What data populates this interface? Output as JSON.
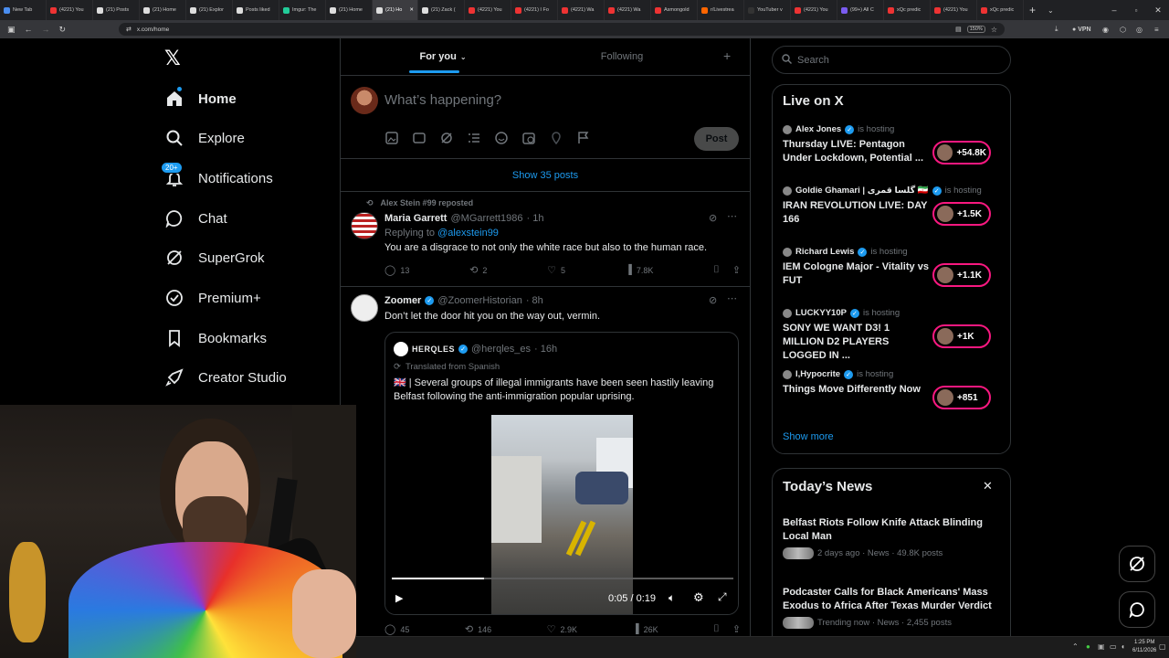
{
  "browser": {
    "tabs": [
      {
        "label": "New Tab",
        "color": "#4a8ef0"
      },
      {
        "label": "(4221) You",
        "color": "#e33"
      },
      {
        "label": "(21) Posts",
        "color": "#ddd"
      },
      {
        "label": "(21) Home",
        "color": "#ddd"
      },
      {
        "label": "(21) Explor",
        "color": "#ddd"
      },
      {
        "label": "Posts liked",
        "color": "#ddd"
      },
      {
        "label": "Imgur: The",
        "color": "#2c9"
      },
      {
        "label": "(21) Home",
        "color": "#ddd"
      },
      {
        "label": "(21) Ho",
        "color": "#ddd",
        "active": true
      },
      {
        "label": "(21) Zack (",
        "color": "#ddd"
      },
      {
        "label": "(4221) You",
        "color": "#e33"
      },
      {
        "label": "(4221) I Fo",
        "color": "#e33"
      },
      {
        "label": "(4221) Wa",
        "color": "#e33"
      },
      {
        "label": "(4221) Wa",
        "color": "#e33"
      },
      {
        "label": "Asmongold",
        "color": "#e33"
      },
      {
        "label": "r/Livestrea",
        "color": "#f60"
      },
      {
        "label": "YouTuber v",
        "color": "#333"
      },
      {
        "label": "(4221) You",
        "color": "#e33"
      },
      {
        "label": "(99+) All C",
        "color": "#7a5cf0"
      },
      {
        "label": "xQc predic",
        "color": "#e33"
      },
      {
        "label": "(4221) You",
        "color": "#e33"
      },
      {
        "label": "xQc predic",
        "color": "#e33"
      }
    ],
    "url": "x.com/home",
    "zoom": "150%",
    "vpn": "VPN"
  },
  "nav": {
    "home": "Home",
    "explore": "Explore",
    "notifications": "Notifications",
    "notif_badge": "20+",
    "chat": "Chat",
    "supergrok": "SuperGrok",
    "premium": "Premium+",
    "bookmarks": "Bookmarks",
    "creator": "Creator Studio"
  },
  "feed": {
    "tab_foryou": "For you",
    "tab_following": "Following",
    "compose_placeholder": "What’s happening?",
    "post_button": "Post",
    "show_posts": "Show 35 posts",
    "post1": {
      "repost_by": "Alex Stein #99 reposted",
      "name": "Maria Garrett",
      "handle": "@MGarrett1986",
      "time": "· 1h",
      "reply_label": "Replying to",
      "reply_to": "@alexstein99",
      "text": "You are a disgrace to not only the white race but also to the human race.",
      "replies": "13",
      "reposts": "2",
      "likes": "5",
      "views": "7.8K"
    },
    "post2": {
      "name": "Zoomer",
      "handle": "@ZoomerHistorian",
      "time": "· 8h",
      "text": "Don’t let the door hit you on the way out, vermin.",
      "quote_name": "HERQLES",
      "quote_handle": "@herqles_es",
      "quote_time": "· 16h",
      "translated": "Translated from Spanish",
      "quote_text": "🇬🇧 | Several groups of illegal immigrants have been seen hastily leaving Belfast following the anti-immigration popular uprising.",
      "video_time": "0:05 / 0:19",
      "video_progress": 0.27,
      "replies": "45",
      "reposts": "146",
      "likes": "2.9K",
      "views": "26K"
    }
  },
  "sidebar": {
    "search_placeholder": "Search",
    "live_title": "Live on X",
    "is_hosting": "is hosting",
    "live": [
      {
        "host": "Alex Jones",
        "title": "Thursday LIVE: Pentagon Under Lockdown, Potential ...",
        "count": "+54.8K"
      },
      {
        "host": "Goldie Ghamari | گلسا قمری 🇮🇷",
        "title": "IRAN REVOLUTION LIVE: DAY 166",
        "count": "+1.5K"
      },
      {
        "host": "Richard Lewis",
        "title": "IEM Cologne Major - Vitality vs FUT",
        "count": "+1.1K"
      },
      {
        "host": "LUCKYY10P",
        "title": "SONY WE WANT D3! 1 MILLION D2 PLAYERS LOGGED IN ...",
        "count": "+1K"
      },
      {
        "host": "I,Hypocrite",
        "title": "Things Move Differently Now",
        "count": "+851"
      }
    ],
    "show_more": "Show more",
    "news_title": "Today’s News",
    "news": [
      {
        "title": "Belfast Riots Follow Knife Attack Blinding Local Man",
        "meta": "2 days ago · News · 49.8K posts"
      },
      {
        "title": "Podcaster Calls for Black Americans' Mass Exodus to Africa After Texas Murder Verdict",
        "meta": "Trending now · News · 2,455 posts"
      }
    ]
  },
  "taskbar": {
    "time": "1:25 PM",
    "date": "6/11/2026"
  }
}
